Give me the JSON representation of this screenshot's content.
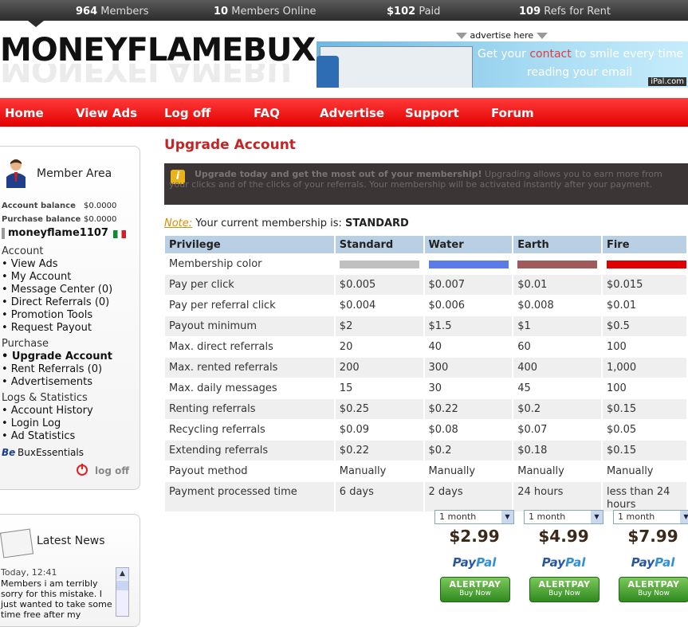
{
  "stats": {
    "members_count": "964",
    "members_label": "Members",
    "online_count": "10",
    "online_label": "Members Online",
    "paid_amount": "$102",
    "paid_label": "Paid",
    "refs_count": "109",
    "refs_label": "Refs for Rent"
  },
  "site": {
    "logo": "MONEYFLAMEBUX"
  },
  "advertise": {
    "label": "advertise here",
    "banner_line1_a": "Get your ",
    "banner_line1_hl": "contact",
    "banner_line1_b": " to smile every time",
    "banner_line2": "reading your email",
    "banner_brand": "iPal.com"
  },
  "nav": [
    "Home",
    "View Ads",
    "Log off",
    "FAQ",
    "Advertise",
    "Support",
    "Forum"
  ],
  "member_area": {
    "title": "Member Area",
    "account_balance_label": "Account balance",
    "account_balance_value": "$0.0000",
    "purchase_balance_label": "Purchase balance",
    "purchase_balance_value": "$0.0000",
    "username": "moneyflame1107",
    "sections": {
      "account": "Account",
      "purchase": "Purchase",
      "logs": "Logs & Statistics"
    },
    "account_items": [
      "• View Ads",
      "• My Account",
      "• Message Center (0)",
      "• Direct Referrals (0)",
      "• Promotion Tools",
      "• Request Payout"
    ],
    "purchase_items": [
      "• Upgrade Account",
      "• Rent Referrals (0)",
      "• Advertisements"
    ],
    "logs_items": [
      "• Account History",
      "• Login Log",
      "• Ad Statistics"
    ],
    "bux_essentials": "BuxEssentials",
    "log_off": "log off"
  },
  "news": {
    "title": "Latest News",
    "date": "Today, 12:41",
    "text": "Members i am terribly sorry for this mistake. I just wanted to take some time free after my"
  },
  "main": {
    "title": "Upgrade Account",
    "promo_bold": "Upgrade today and get the most out of your membership!",
    "promo_text": " Upgrading allows you to earn more from your clicks and of the clicks of your referrals. Your membership will be activated instantly after your payment.",
    "note_label": "Note:",
    "note_text": " Your current membership is: ",
    "note_level": "STANDARD"
  },
  "table": {
    "headers": [
      "Privilege",
      "Standard",
      "Water",
      "Earth",
      "Fire"
    ],
    "swatch_colors": [
      "#c0c0c0",
      "#5b7be8",
      "#a05a5a",
      "#e00000"
    ],
    "rows": [
      [
        "Membership color",
        "",
        "",
        "",
        ""
      ],
      [
        "Pay per click",
        "$0.005",
        "$0.007",
        "$0.01",
        "$0.015"
      ],
      [
        "Pay per referral click",
        "$0.004",
        "$0.006",
        "$0.008",
        "$0.01"
      ],
      [
        "Payout minimum",
        "$2",
        "$1.5",
        "$1",
        "$0.5"
      ],
      [
        "Max. direct referrals",
        "20",
        "40",
        "60",
        "100"
      ],
      [
        "Max. rented referrals",
        "200",
        "300",
        "400",
        "1,000"
      ],
      [
        "Max. daily messages",
        "15",
        "30",
        "45",
        "100"
      ],
      [
        "Renting referrals",
        "$0.25",
        "$0.22",
        "$0.2",
        "$0.15"
      ],
      [
        "Recycling referrals",
        "$0.09",
        "$0.08",
        "$0.07",
        "$0.05"
      ],
      [
        "Extending referrals",
        "$0.22",
        "$0.2",
        "$0.18",
        "$0.15"
      ],
      [
        "Payout method",
        "Manually",
        "Manually",
        "Manually",
        "Manually"
      ],
      [
        "Payment processed time",
        "6 days",
        "2 days",
        "24 hours",
        "less than 24 hours"
      ]
    ]
  },
  "plans": [
    {
      "duration": "1 month",
      "price": "$2.99"
    },
    {
      "duration": "1 month",
      "price": "$4.99"
    },
    {
      "duration": "1 month",
      "price": "$7.99"
    }
  ],
  "paypal": {
    "pay": "Pay",
    "pal": "Pal"
  },
  "alertpay": {
    "name": "ALERTPAY",
    "buy": "Buy Now"
  }
}
